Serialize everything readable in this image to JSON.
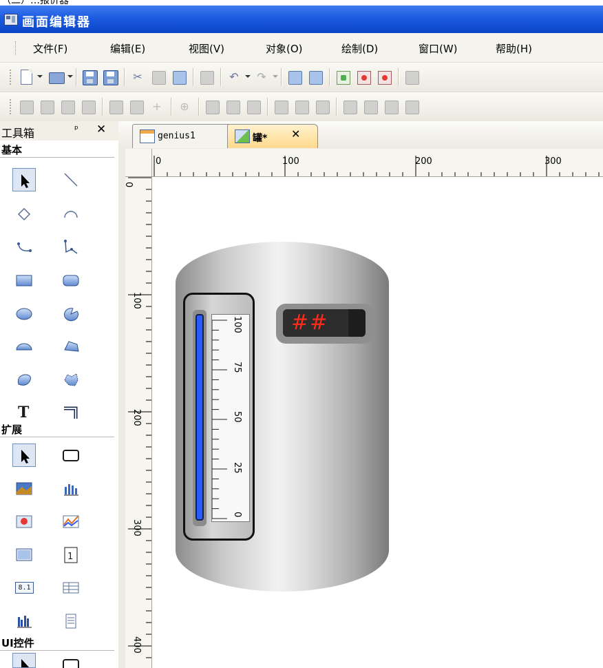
{
  "top_strip_text": "（二）…报价器",
  "window": {
    "title": "画面编辑器"
  },
  "menu": [
    {
      "label": "文件(F)"
    },
    {
      "label": "编辑(E)"
    },
    {
      "label": "视图(V)"
    },
    {
      "label": "对象(O)"
    },
    {
      "label": "绘制(D)"
    },
    {
      "label": "窗口(W)"
    },
    {
      "label": "帮助(H)"
    }
  ],
  "toolbox": {
    "title": "工具箱",
    "pin": "ᵖ",
    "close": "✕",
    "sections": {
      "basic": "基本",
      "extended": "扩展",
      "ui": "UI控件"
    },
    "text_tool_glyph": "T",
    "digital_glyph": "8.1"
  },
  "tabs": [
    {
      "label": "genius1"
    },
    {
      "label": "罐*",
      "close": "✕"
    }
  ],
  "ruler": {
    "h_labels": [
      "0",
      "100",
      "200",
      "300"
    ],
    "v_labels": [
      "0",
      "100",
      "200",
      "300",
      "400"
    ]
  },
  "gauge": {
    "scale_labels": [
      "100",
      "75",
      "50",
      "25",
      "0"
    ],
    "fill_fraction": 1.0,
    "fill_color": "#2a5bff"
  },
  "display": {
    "text": "##"
  },
  "colors": {
    "titlebar": "#1c5be0",
    "active_tab": "#ffd98c",
    "display_text": "#ff2a1a"
  }
}
